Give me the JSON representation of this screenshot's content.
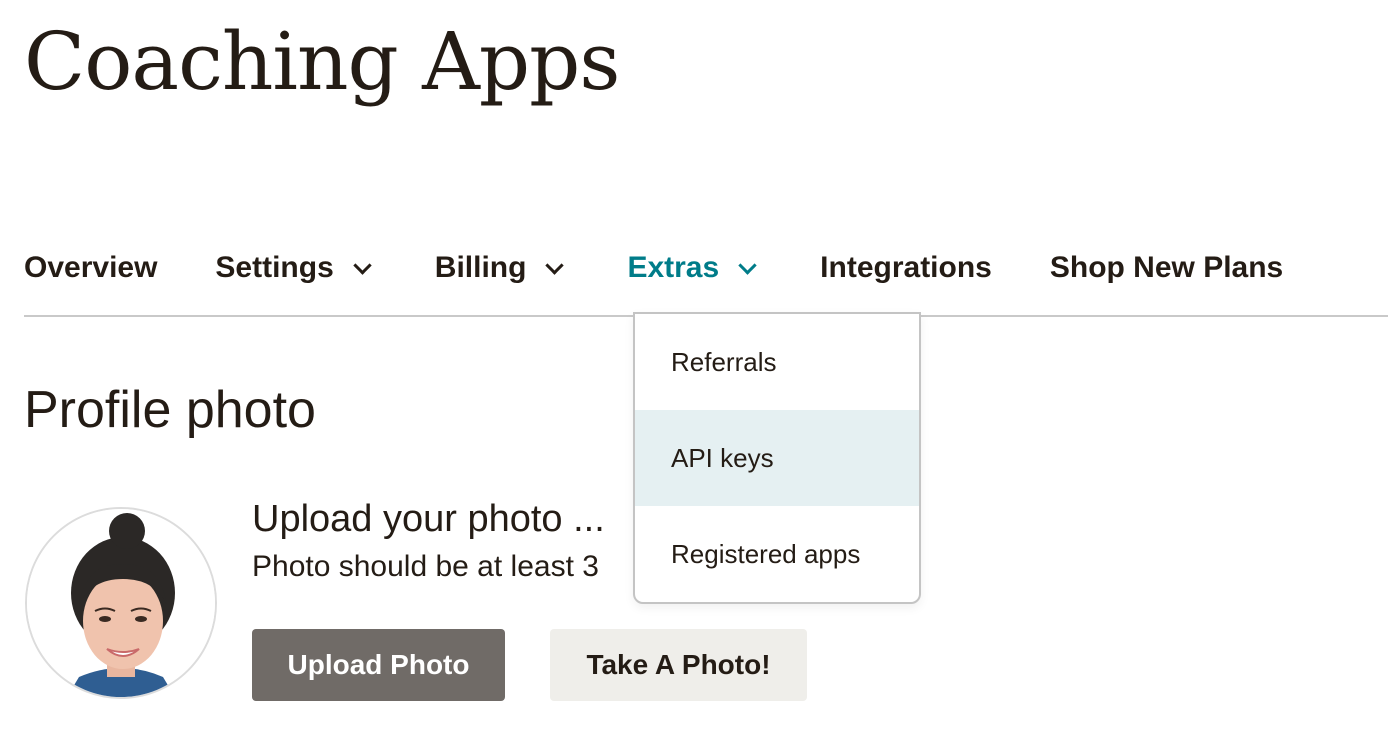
{
  "header": {
    "title": "Coaching Apps"
  },
  "nav": {
    "items": [
      {
        "label": "Overview",
        "has_dropdown": false,
        "active": false
      },
      {
        "label": "Settings",
        "has_dropdown": true,
        "active": false
      },
      {
        "label": "Billing",
        "has_dropdown": true,
        "active": false
      },
      {
        "label": "Extras",
        "has_dropdown": true,
        "active": true
      },
      {
        "label": "Integrations",
        "has_dropdown": false,
        "active": false
      },
      {
        "label": "Shop New Plans",
        "has_dropdown": false,
        "active": false
      }
    ],
    "active_color": "#007c89"
  },
  "extras_menu": {
    "items": [
      {
        "label": "Referrals"
      },
      {
        "label": "API keys",
        "hovered": true
      },
      {
        "label": "Registered apps"
      }
    ],
    "hover_color": "#e5f0f2"
  },
  "profile": {
    "section_title": "Profile photo",
    "upload_heading": "Upload your photo ...",
    "upload_hint": "Photo should be at least 3",
    "avatar_alt": "profile-photo",
    "buttons": {
      "upload": "Upload Photo",
      "take": "Take A Photo!"
    }
  }
}
